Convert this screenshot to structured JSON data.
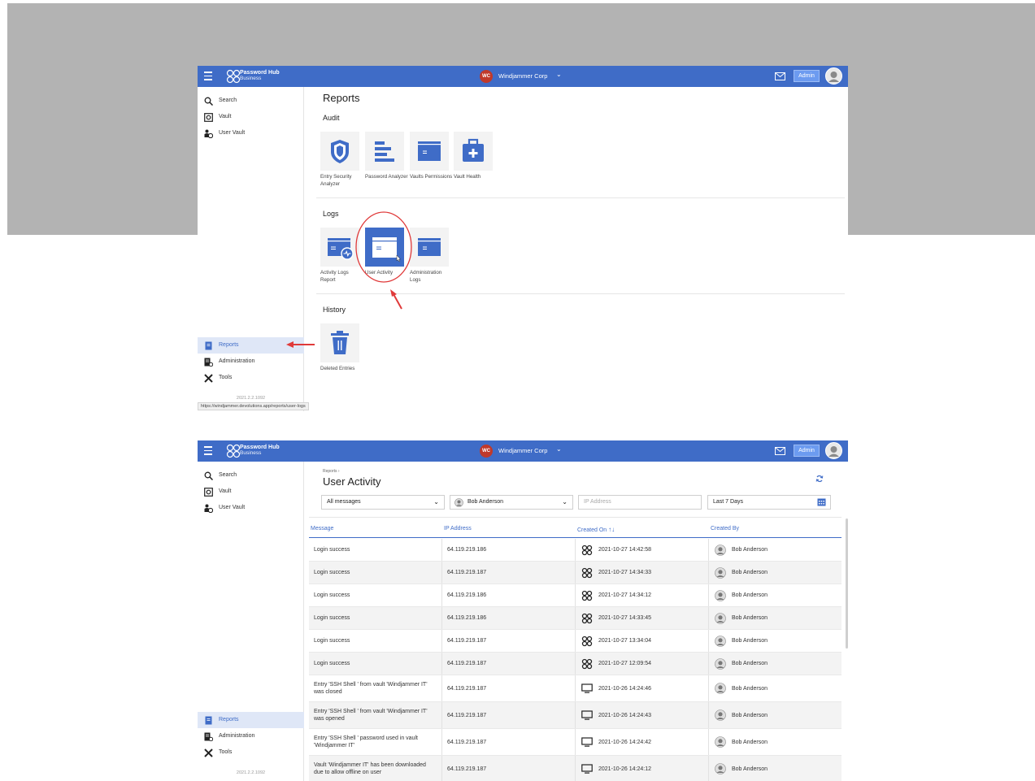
{
  "app": {
    "brand_name": "Password Hub",
    "brand_sub": "Business",
    "org_initials": "WC",
    "org_name": "Windjammer Corp",
    "admin_label": "Admin"
  },
  "sidebar": {
    "top_items": [
      {
        "label": "Search",
        "icon": "search-icon"
      },
      {
        "label": "Vault",
        "icon": "vault-icon"
      },
      {
        "label": "User Vault",
        "icon": "user-vault-icon"
      }
    ],
    "bottom_items": [
      {
        "label": "Reports",
        "icon": "reports-icon",
        "active": true
      },
      {
        "label": "Administration",
        "icon": "administration-icon"
      },
      {
        "label": "Tools",
        "icon": "tools-icon"
      }
    ],
    "version": "2021.2.2.1092"
  },
  "reports_page": {
    "title": "Reports",
    "sections": {
      "audit": {
        "heading": "Audit",
        "tiles": [
          {
            "label": "Entry Security Analyzer",
            "icon": "shield-icon"
          },
          {
            "label": "Password Analyzer",
            "icon": "bars-icon"
          },
          {
            "label": "Vaults Permissions",
            "icon": "window-icon"
          },
          {
            "label": "Vault Health",
            "icon": "medkit-icon"
          }
        ]
      },
      "logs": {
        "heading": "Logs",
        "tiles": [
          {
            "label": "Activity Logs Report",
            "icon": "activity-log-icon"
          },
          {
            "label": "User Activity",
            "icon": "window-icon"
          },
          {
            "label": "Administration Logs",
            "icon": "window-icon"
          }
        ]
      },
      "history": {
        "heading": "History",
        "tiles": [
          {
            "label": "Deleted Entries",
            "icon": "trash-icon"
          }
        ]
      }
    },
    "status_url": "https://windjammer.devolutions.app/reports/user-logs"
  },
  "user_activity_page": {
    "breadcrumb": "Reports ›",
    "title": "User Activity",
    "filters": {
      "messages": "All messages",
      "user": "Bob Anderson",
      "ip_placeholder": "IP Address",
      "period": "Last 7 Days"
    },
    "columns": [
      "Message",
      "IP Address",
      "Created On",
      "Created By"
    ],
    "sort_indicator": "↑↓",
    "rows": [
      {
        "message": "Login success",
        "ip": "64.119.219.186",
        "date": "2021-10-27 14:42:58",
        "source": "web",
        "by": "Bob Anderson"
      },
      {
        "message": "Login success",
        "ip": "64.119.219.187",
        "date": "2021-10-27 14:34:33",
        "source": "web",
        "by": "Bob Anderson"
      },
      {
        "message": "Login success",
        "ip": "64.119.219.186",
        "date": "2021-10-27 14:34:12",
        "source": "web",
        "by": "Bob Anderson"
      },
      {
        "message": "Login success",
        "ip": "64.119.219.186",
        "date": "2021-10-27 14:33:45",
        "source": "web",
        "by": "Bob Anderson"
      },
      {
        "message": "Login success",
        "ip": "64.119.219.187",
        "date": "2021-10-27 13:34:04",
        "source": "web",
        "by": "Bob Anderson"
      },
      {
        "message": "Login success",
        "ip": "64.119.219.187",
        "date": "2021-10-27 12:09:54",
        "source": "web",
        "by": "Bob Anderson"
      },
      {
        "message": "Entry 'SSH Shell ' from vault 'Windjammer IT' was closed",
        "ip": "64.119.219.187",
        "date": "2021-10-26 14:24:46",
        "source": "desktop",
        "by": "Bob Anderson"
      },
      {
        "message": "Entry 'SSH Shell ' from vault 'Windjammer IT' was opened",
        "ip": "64.119.219.187",
        "date": "2021-10-26 14:24:43",
        "source": "desktop",
        "by": "Bob Anderson"
      },
      {
        "message": "Entry 'SSH Shell ' password used in vault 'Windjammer IT'",
        "ip": "64.119.219.187",
        "date": "2021-10-26 14:24:42",
        "source": "desktop",
        "by": "Bob Anderson"
      },
      {
        "message": "Vault 'Windjammer IT' has been downloaded due to allow offline on user",
        "ip": "64.119.219.187",
        "date": "2021-10-26 14:24:12",
        "source": "desktop",
        "by": "Bob Anderson"
      }
    ]
  },
  "colors": {
    "brand_blue": "#3f6cc7",
    "annotation_red": "#e03a3a",
    "background_band": "#b3b3b3"
  }
}
